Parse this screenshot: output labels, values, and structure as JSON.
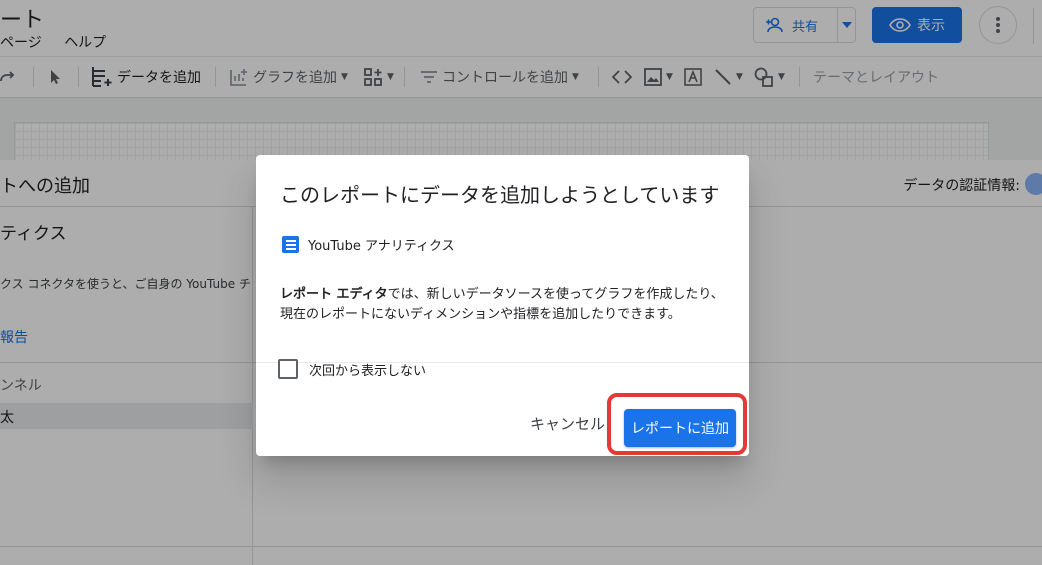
{
  "app": {
    "title": "ート",
    "menus": [
      "ページ",
      "ヘルプ"
    ]
  },
  "header": {
    "share_label": "共有",
    "view_label": "表示"
  },
  "toolbar": {
    "add_data_label": "データを追加",
    "add_chart_label": "グラフを追加",
    "add_control_label": "コントロールを追加",
    "theme_layout_label": "テーマとレイアウト"
  },
  "panel": {
    "title": "トへの追加",
    "credentials_label": "データの認証情報:",
    "connector_title": "ティクス",
    "connector_desc": "クス コネクタを使うと、ご自身の YouTube チ",
    "link_text": "報告",
    "channel_header": "ンネル",
    "selected_channel": "太"
  },
  "dialog": {
    "title": "このレポートにデータを追加しようとしています",
    "data_source": "YouTube アナリティクス",
    "body_bold": "レポート エディタ",
    "body_text": "では、新しいデータソースを使ってグラフを作成したり、現在のレポートにないディメンションや指標を追加したりできます。",
    "checkbox_label": "次回から表示しない",
    "cancel_label": "キャンセル",
    "confirm_label": "レポートに追加"
  },
  "colors": {
    "primary": "#1a73e8",
    "highlight": "#e53935"
  }
}
